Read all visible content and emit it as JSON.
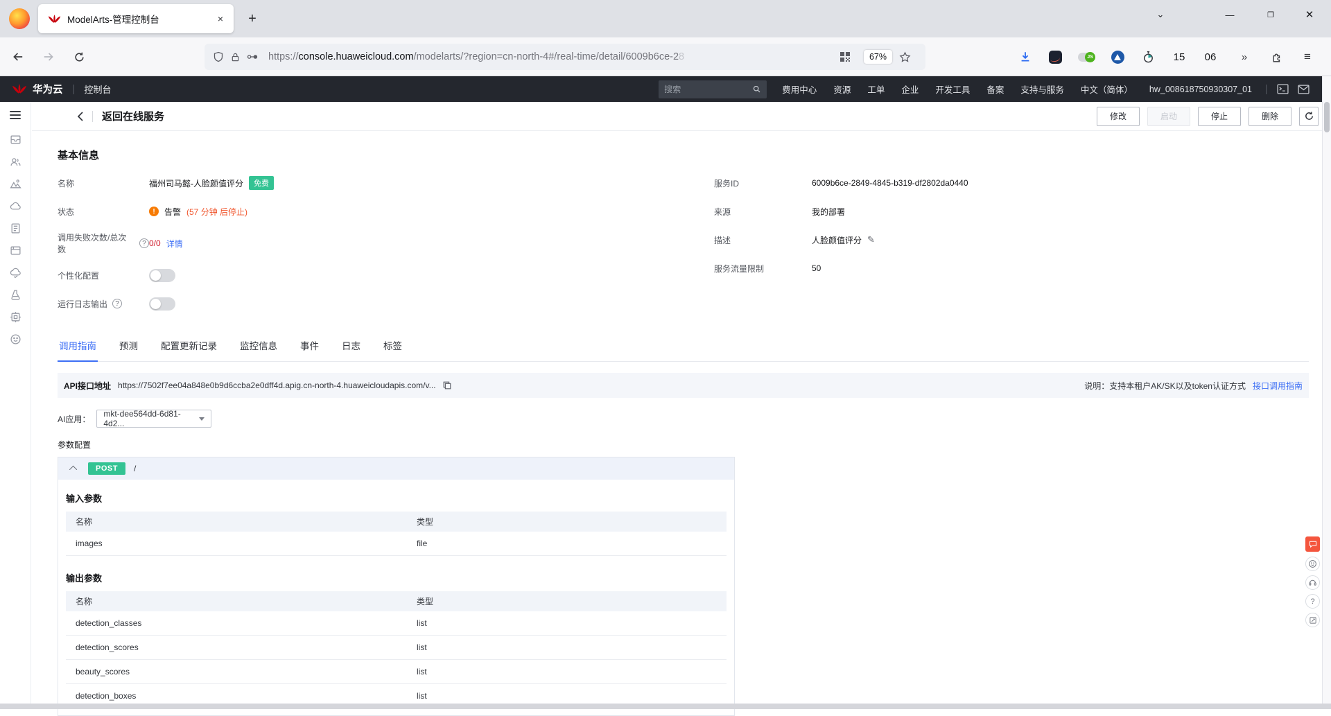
{
  "browser": {
    "tab_title": "ModelArts-管理控制台",
    "close_tab": "×",
    "new_tab": "+",
    "window": {
      "tabs_chevron": "⌄",
      "minimize": "—",
      "restore": "❐",
      "close": "✕"
    },
    "url": {
      "protocol": "https://",
      "host": "console.huaweicloud.com",
      "path": "/modelarts/?region=cn-north-4#/real-time/detail/6009b6ce-2",
      "faded": "8"
    },
    "zoom_level": "67%",
    "clock_hour": "15",
    "clock_min": "06",
    "overflow_chevron": "»",
    "js_badge": "JS",
    "menu_glyph": "≡"
  },
  "header": {
    "brand": "华为云",
    "console": "控制台",
    "search_placeholder": "搜索",
    "nav": [
      "费用中心",
      "资源",
      "工单",
      "企业",
      "开发工具",
      "备案",
      "支持与服务",
      "中文（简体）",
      "hw_008618750930307_01"
    ]
  },
  "titlebar": {
    "back_label": "返回在线服务",
    "modify": "修改",
    "start": "启动",
    "stop": "停止",
    "delete": "删除"
  },
  "basic": {
    "title": "基本信息",
    "name_label": "名称",
    "name_value": "福州司马懿-人脸颜值评分",
    "name_badge": "免费",
    "status_label": "状态",
    "status_value": "告警",
    "status_note": "(57 分钟 后停止)",
    "warn_glyph": "!",
    "help_glyph": "?",
    "calls_label": "调用失败次数/总次数",
    "calls_value": "0/0",
    "calls_link": "详情",
    "personalize_label": "个性化配置",
    "log_label": "运行日志输出",
    "service_id_label": "服务ID",
    "service_id": "6009b6ce-2849-4845-b319-df2802da0440",
    "source_label": "来源",
    "source": "我的部署",
    "desc_label": "描述",
    "desc": "人脸颜值评分",
    "edit_glyph": "✎",
    "limit_label": "服务流量限制",
    "limit": "50"
  },
  "tabs": [
    "调用指南",
    "预测",
    "配置更新记录",
    "监控信息",
    "事件",
    "日志",
    "标签"
  ],
  "api": {
    "label": "API接口地址",
    "url": "https://7502f7ee04a848e0b9d6ccba2e0dff4d.apig.cn-north-4.huaweicloudapis.com/v...",
    "note": "说明：支持本租户AK/SK以及token认证方式",
    "guide_link": "接口调用指南"
  },
  "ai_app": {
    "label": "AI应用：",
    "value": "mkt-dee564dd-6d81-4d2..."
  },
  "params": {
    "title": "参数配置",
    "method": "POST",
    "path": "/",
    "input_title": "输入参数",
    "output_title": "输出参数",
    "col_name": "名称",
    "col_type": "类型",
    "input_rows": [
      {
        "name": "images",
        "type": "file"
      }
    ],
    "output_rows": [
      {
        "name": "detection_classes",
        "type": "list"
      },
      {
        "name": "detection_scores",
        "type": "list"
      },
      {
        "name": "beauty_scores",
        "type": "list"
      },
      {
        "name": "detection_boxes",
        "type": "list"
      }
    ]
  },
  "help_question": "?"
}
